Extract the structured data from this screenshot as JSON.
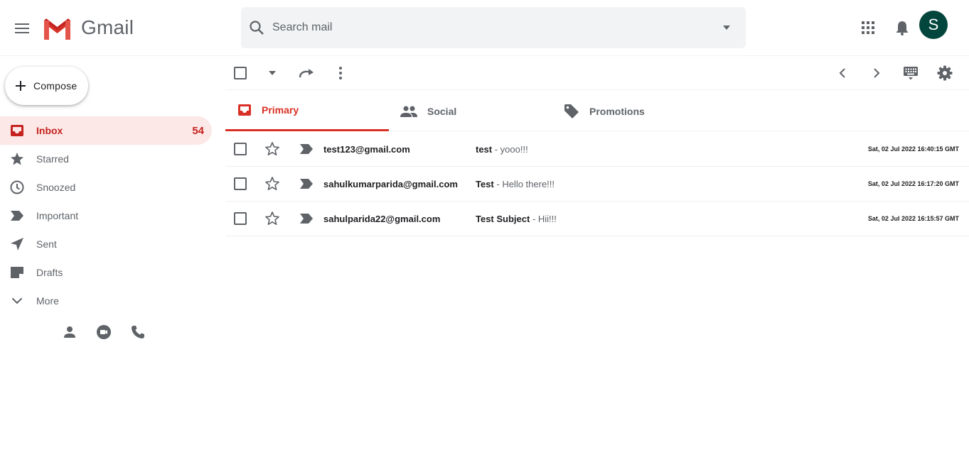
{
  "app": {
    "title": "Gmail",
    "brand_color": "#d93025",
    "avatar_color": "#03463d"
  },
  "header": {
    "logo_text": "Gmail",
    "search_placeholder": "Search mail",
    "avatar_initial": "S",
    "icons": [
      "menu-icon",
      "search-icon",
      "caret-down-icon",
      "apps-grid-icon",
      "bell-icon"
    ]
  },
  "sidebar": {
    "compose_label": "Compose",
    "items": [
      {
        "label": "Inbox",
        "count": "54",
        "icon": "inbox-icon",
        "active": true
      },
      {
        "label": "Starred",
        "icon": "star-icon"
      },
      {
        "label": "Snoozed",
        "icon": "clock-icon"
      },
      {
        "label": "Important",
        "icon": "important-icon"
      },
      {
        "label": "Sent",
        "icon": "send-icon"
      },
      {
        "label": "Drafts",
        "icon": "draft-icon"
      },
      {
        "label": "More",
        "icon": "chevron-down-icon"
      }
    ],
    "bottom_icons": [
      "person-icon",
      "video-icon",
      "phone-icon"
    ]
  },
  "toolbar": {
    "icons": [
      "select-all-checkbox",
      "caret-down-icon",
      "refresh-icon",
      "more-vert-icon",
      "chevron-left-icon",
      "chevron-right-icon",
      "keyboard-icon",
      "gear-icon"
    ]
  },
  "tabs": [
    {
      "label": "Primary",
      "icon": "inbox-icon",
      "active": true
    },
    {
      "label": "Social",
      "icon": "people-icon"
    },
    {
      "label": "Promotions",
      "icon": "tag-icon"
    }
  ],
  "emails": [
    {
      "sender": "test123@gmail.com",
      "subject": "test",
      "snippet": " - yooo!!!",
      "date": "Sat, 02 Jul 2022 16:40:15 GMT"
    },
    {
      "sender": "sahulkumarparida@gmail.com",
      "subject": "Test",
      "snippet": " - Hello there!!!",
      "date": "Sat, 02 Jul 2022 16:17:20 GMT"
    },
    {
      "sender": "sahulparida22@gmail.com",
      "subject": "Test Subject",
      "snippet": " - Hii!!!",
      "date": "Sat, 02 Jul 2022 16:15:57 GMT"
    }
  ]
}
